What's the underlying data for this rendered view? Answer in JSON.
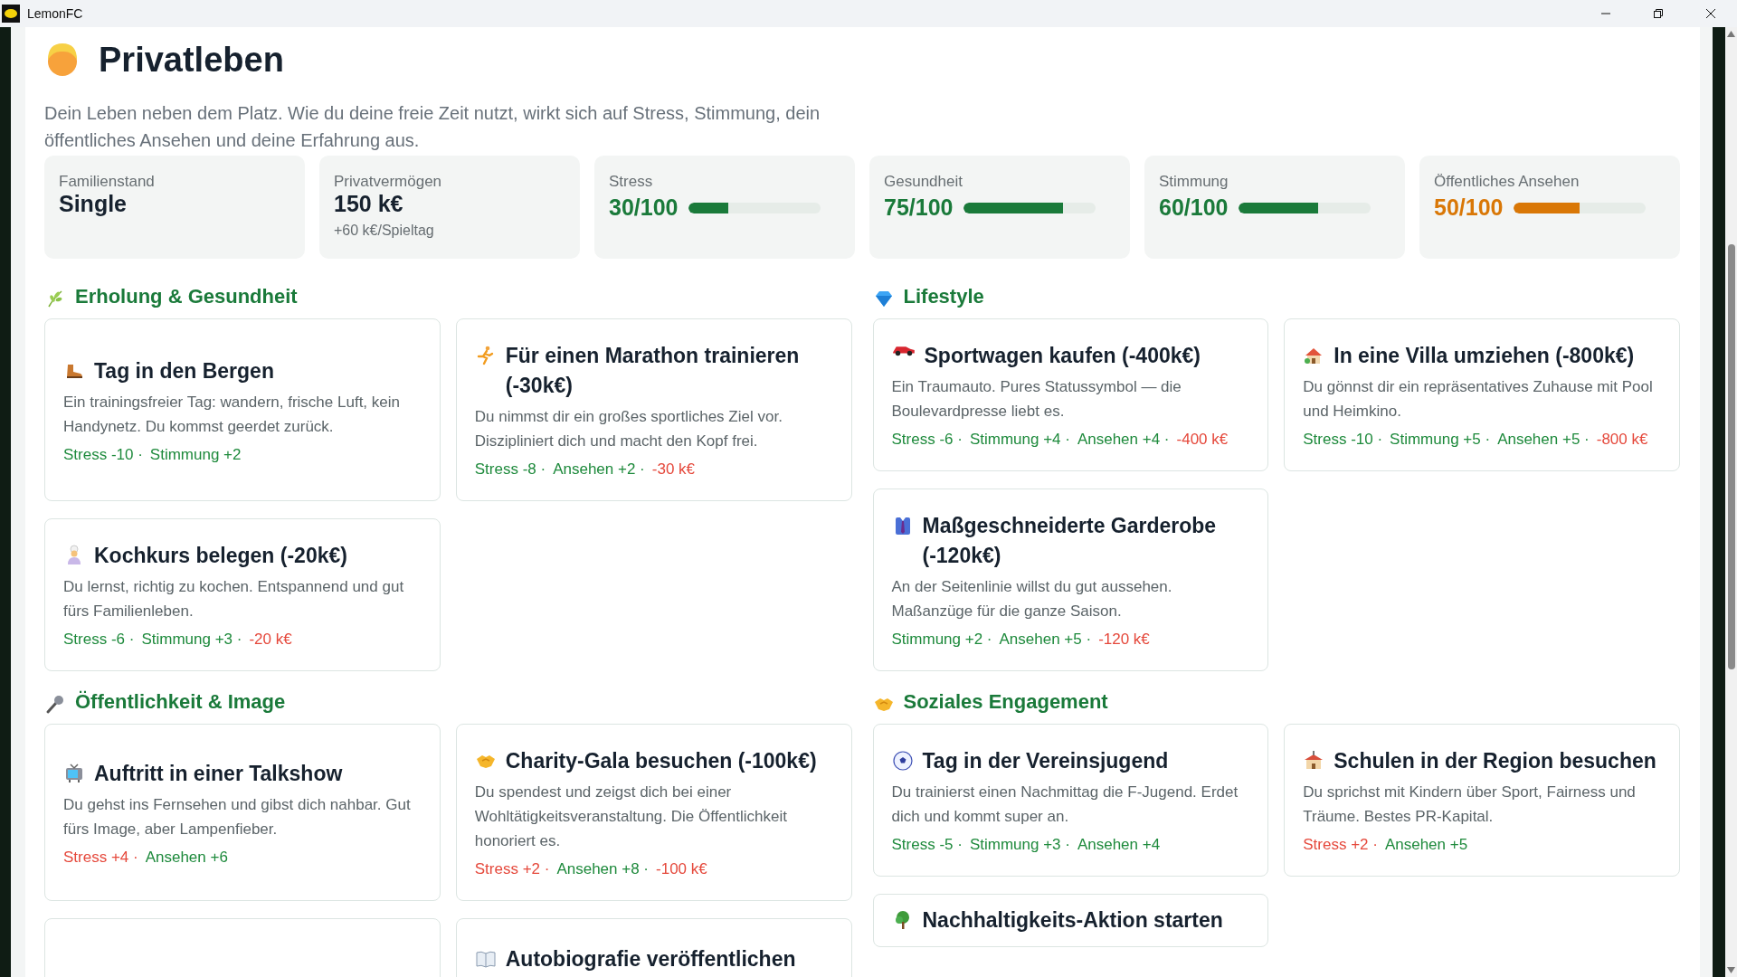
{
  "window": {
    "title": "LemonFC"
  },
  "page": {
    "title": "Privatleben",
    "description": "Dein Leben neben dem Platz. Wie du deine freie Zeit nutzt, wirkt sich auf Stress, Stimmung, dein öffentliches Ansehen und deine Erfahrung aus."
  },
  "stats": [
    {
      "kind": "text",
      "label": "Familienstand",
      "value": "Single"
    },
    {
      "kind": "text",
      "label": "Privatvermögen",
      "value": "150 k€",
      "sub": "+60 k€/Spieltag"
    },
    {
      "kind": "meter",
      "label": "Stress",
      "value": "30/100",
      "level": 0.3,
      "color": "#1a7a3a"
    },
    {
      "kind": "meter",
      "label": "Gesundheit",
      "value": "75/100",
      "level": 0.75,
      "color": "#1a7a3a"
    },
    {
      "kind": "meter",
      "label": "Stimmung",
      "value": "60/100",
      "level": 0.6,
      "color": "#1a7a3a"
    },
    {
      "kind": "meter",
      "label": "Öffentliches Ansehen",
      "value": "50/100",
      "level": 0.5,
      "color": "#d97706"
    }
  ],
  "sections": [
    {
      "title": "Erholung & Gesundheit",
      "cards": [
        {
          "title": "Tag in den Bergen",
          "description": "Ein trainingsfreier Tag: wandern, frische Luft, kein Handynetz. Du kommst geerdet zurück.",
          "effects": [
            {
              "text": "Stress -10 ·",
              "color": "#1e8a3c"
            },
            {
              "text": "Stimmung +2",
              "color": "#1e8a3c"
            }
          ]
        },
        {
          "title": "Für einen Marathon trainieren (-30k€)",
          "description": "Du nimmst dir ein großes sportliches Ziel vor. Diszipliniert dich und macht den Kopf frei.",
          "effects": [
            {
              "text": "Stress -8 ·",
              "color": "#1e8a3c"
            },
            {
              "text": "Ansehen +2 ·",
              "color": "#1e8a3c"
            },
            {
              "text": "-30 k€",
              "color": "#e5483b"
            }
          ]
        },
        {
          "title": "Kochkurs belegen (-20k€)",
          "description": "Du lernst, richtig zu kochen. Entspannend und gut fürs Familienleben.",
          "effects": [
            {
              "text": "Stress -6 ·",
              "color": "#1e8a3c"
            },
            {
              "text": "Stimmung +3 ·",
              "color": "#1e8a3c"
            },
            {
              "text": "-20 k€",
              "color": "#e5483b"
            }
          ]
        }
      ]
    },
    {
      "title": "Lifestyle",
      "cards": [
        {
          "title": "Sportwagen kaufen (-400k€)",
          "description": "Ein Traumauto. Pures Statussymbol — die Boulevardpresse liebt es.",
          "effects": [
            {
              "text": "Stress -6 ·",
              "color": "#1e8a3c"
            },
            {
              "text": "Stimmung +4 ·",
              "color": "#1e8a3c"
            },
            {
              "text": "Ansehen +4 ·",
              "color": "#1e8a3c"
            },
            {
              "text": "-400 k€",
              "color": "#e5483b"
            }
          ]
        },
        {
          "title": "In eine Villa umziehen (-800k€)",
          "description": "Du gönnst dir ein repräsentatives Zuhause mit Pool und Heimkino.",
          "effects": [
            {
              "text": "Stress -10 ·",
              "color": "#1e8a3c"
            },
            {
              "text": "Stimmung +5 ·",
              "color": "#1e8a3c"
            },
            {
              "text": "Ansehen +5 ·",
              "color": "#1e8a3c"
            },
            {
              "text": "-800 k€",
              "color": "#e5483b"
            }
          ]
        },
        {
          "title": "Maßgeschneiderte Garderobe (-120k€)",
          "description": "An der Seitenlinie willst du gut aussehen. Maßanzüge für die ganze Saison.",
          "effects": [
            {
              "text": "Stimmung +2 ·",
              "color": "#1e8a3c"
            },
            {
              "text": "Ansehen +5 ·",
              "color": "#1e8a3c"
            },
            {
              "text": "-120 k€",
              "color": "#e5483b"
            }
          ]
        }
      ]
    },
    {
      "title": "Öffentlichkeit & Image",
      "cards": [
        {
          "title": "Auftritt in einer Talkshow",
          "description": "Du gehst ins Fernsehen und gibst dich nahbar. Gut fürs Image, aber Lampenfieber.",
          "effects": [
            {
              "text": "Stress +4 ·",
              "color": "#e5483b"
            },
            {
              "text": "Ansehen +6",
              "color": "#1e8a3c"
            }
          ]
        },
        {
          "title": "Charity-Gala besuchen (-100k€)",
          "description": "Du spendest und zeigst dich bei einer Wohltätigkeitsveranstaltung. Die Öffentlichkeit honoriert es.",
          "effects": [
            {
              "text": "Stress +2 ·",
              "color": "#e5483b"
            },
            {
              "text": "Ansehen +8 ·",
              "color": "#1e8a3c"
            },
            {
              "text": "-100 k€",
              "color": "#e5483b"
            }
          ]
        },
        {
          "kind": "blank"
        },
        {
          "title": "Autobiografie veröffentlichen"
        }
      ]
    },
    {
      "title": "Soziales Engagement",
      "cards": [
        {
          "title": "Tag in der Vereinsjugend",
          "description": "Du trainierst einen Nachmittag die F-Jugend. Erdet dich und kommt super an.",
          "effects": [
            {
              "text": "Stress -5 ·",
              "color": "#1e8a3c"
            },
            {
              "text": "Stimmung +3 ·",
              "color": "#1e8a3c"
            },
            {
              "text": "Ansehen +4",
              "color": "#1e8a3c"
            }
          ]
        },
        {
          "title": "Schulen in der Region besuchen",
          "description": "Du sprichst mit Kindern über Sport, Fairness und Träume. Bestes PR-Kapital.",
          "effects": [
            {
              "text": "Stress +2 ·",
              "color": "#e5483b"
            },
            {
              "text": "Ansehen +5",
              "color": "#1e8a3c"
            }
          ]
        },
        {
          "title": "Nachhaltigkeits-Aktion starten"
        }
      ]
    }
  ]
}
